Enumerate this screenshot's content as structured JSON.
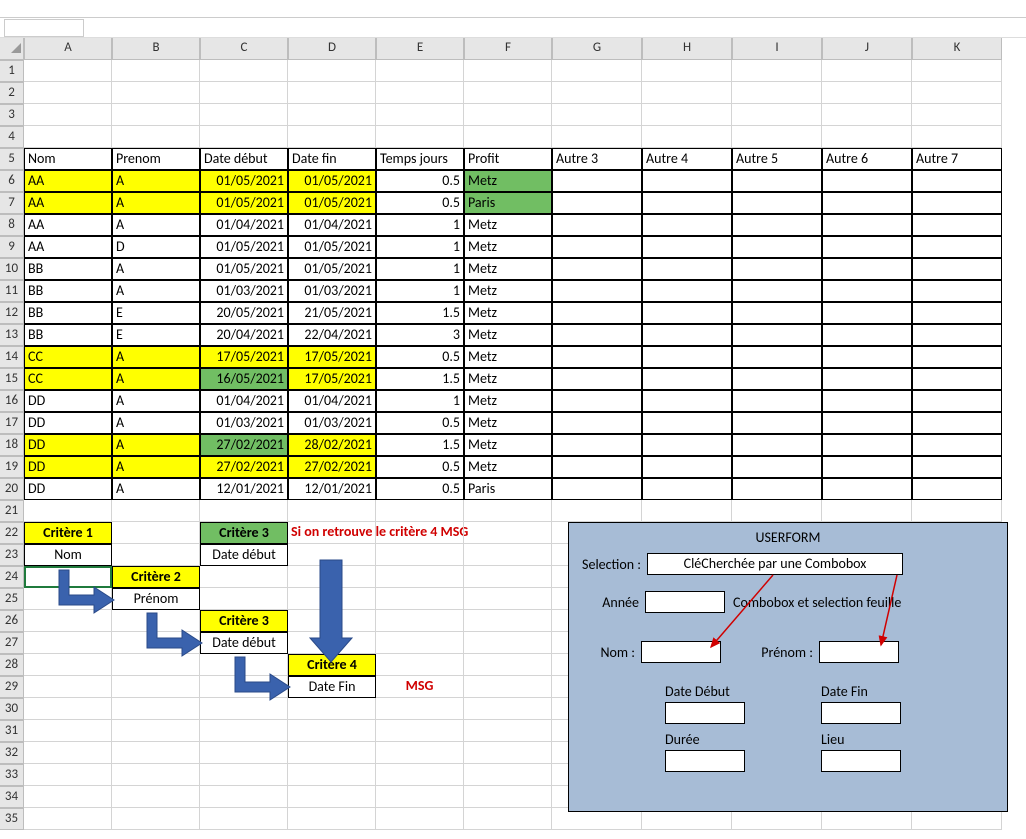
{
  "columns": [
    "A",
    "B",
    "C",
    "D",
    "E",
    "F",
    "G",
    "H",
    "I",
    "J",
    "K"
  ],
  "row_count_blank_top": 4,
  "headers": {
    "r5": [
      "Nom",
      "Prenom",
      "Date début",
      "Date fin",
      "Temps jours",
      "Profit",
      "Autre 3",
      "Autre 4",
      "Autre 5",
      "Autre 6",
      "Autre 7"
    ]
  },
  "rows": [
    {
      "n": 6,
      "nom": "AA",
      "pre": "A",
      "dd": "01/05/2021",
      "df": "01/05/2021",
      "tj": "0.5",
      "pf": "Metz",
      "hl": "yellow",
      "pf_hl": "green"
    },
    {
      "n": 7,
      "nom": "AA",
      "pre": "A",
      "dd": "01/05/2021",
      "df": "01/05/2021",
      "tj": "0.5",
      "pf": "Paris",
      "hl": "yellow",
      "pf_hl": "green"
    },
    {
      "n": 8,
      "nom": "AA",
      "pre": "A",
      "dd": "01/04/2021",
      "df": "01/04/2021",
      "tj": "1",
      "pf": "Metz"
    },
    {
      "n": 9,
      "nom": "AA",
      "pre": "D",
      "dd": "01/05/2021",
      "df": "01/05/2021",
      "tj": "1",
      "pf": "Metz"
    },
    {
      "n": 10,
      "nom": "BB",
      "pre": "A",
      "dd": "01/05/2021",
      "df": "01/05/2021",
      "tj": "1",
      "pf": "Metz"
    },
    {
      "n": 11,
      "nom": "BB",
      "pre": "A",
      "dd": "01/03/2021",
      "df": "01/03/2021",
      "tj": "1",
      "pf": "Metz"
    },
    {
      "n": 12,
      "nom": "BB",
      "pre": "E",
      "dd": "20/05/2021",
      "df": "21/05/2021",
      "tj": "1.5",
      "pf": "Metz"
    },
    {
      "n": 13,
      "nom": "BB",
      "pre": "E",
      "dd": "20/04/2021",
      "df": "22/04/2021",
      "tj": "3",
      "pf": "Metz"
    },
    {
      "n": 14,
      "nom": "CC",
      "pre": "A",
      "dd": "17/05/2021",
      "df": "17/05/2021",
      "tj": "0.5",
      "pf": "Metz",
      "hl": "yellow"
    },
    {
      "n": 15,
      "nom": "CC",
      "pre": "A",
      "dd": "16/05/2021",
      "df": "17/05/2021",
      "tj": "1.5",
      "pf": "Metz",
      "hl": "yellow",
      "dd_hl": "green"
    },
    {
      "n": 16,
      "nom": "DD",
      "pre": "A",
      "dd": "01/04/2021",
      "df": "01/04/2021",
      "tj": "1",
      "pf": "Metz"
    },
    {
      "n": 17,
      "nom": "DD",
      "pre": "A",
      "dd": "01/03/2021",
      "df": "01/03/2021",
      "tj": "0.5",
      "pf": "Metz"
    },
    {
      "n": 18,
      "nom": "DD",
      "pre": "A",
      "dd": "27/02/2021",
      "df": "28/02/2021",
      "tj": "1.5",
      "pf": "Metz",
      "hl": "yellow",
      "dd_hl": "green"
    },
    {
      "n": 19,
      "nom": "DD",
      "pre": "A",
      "dd": "27/02/2021",
      "df": "27/02/2021",
      "tj": "0.5",
      "pf": "Metz",
      "hl": "yellow"
    },
    {
      "n": 20,
      "nom": "DD",
      "pre": "A",
      "dd": "12/01/2021",
      "df": "12/01/2021",
      "tj": "0.5",
      "pf": "Paris"
    }
  ],
  "criteria": {
    "c1_title": "Critère 1",
    "c1_val": "Nom",
    "c2_title": "Critère 2",
    "c2_val": "Prénom",
    "c3a_title": "Critère 3",
    "c3a_val": "Date début",
    "c3b_title": "Critère 3",
    "c3b_val": "Date début",
    "c4_title": "Critère 4",
    "c4_val": "Date Fin",
    "warn": "Si on retrouve le critère 4 MSG",
    "msg": "MSG"
  },
  "userform": {
    "title": "USERFORM",
    "sel_label": "Selection :",
    "sel_val": "CléCherchée par une Combobox",
    "annee_label": "Année",
    "annee_note": "Combobox et selection feuille",
    "nom_label": "Nom :",
    "prenom_label": "Prénom :",
    "dd_label": "Date Début",
    "df_label": "Date Fin",
    "duree_label": "Durée",
    "lieu_label": "Lieu"
  }
}
